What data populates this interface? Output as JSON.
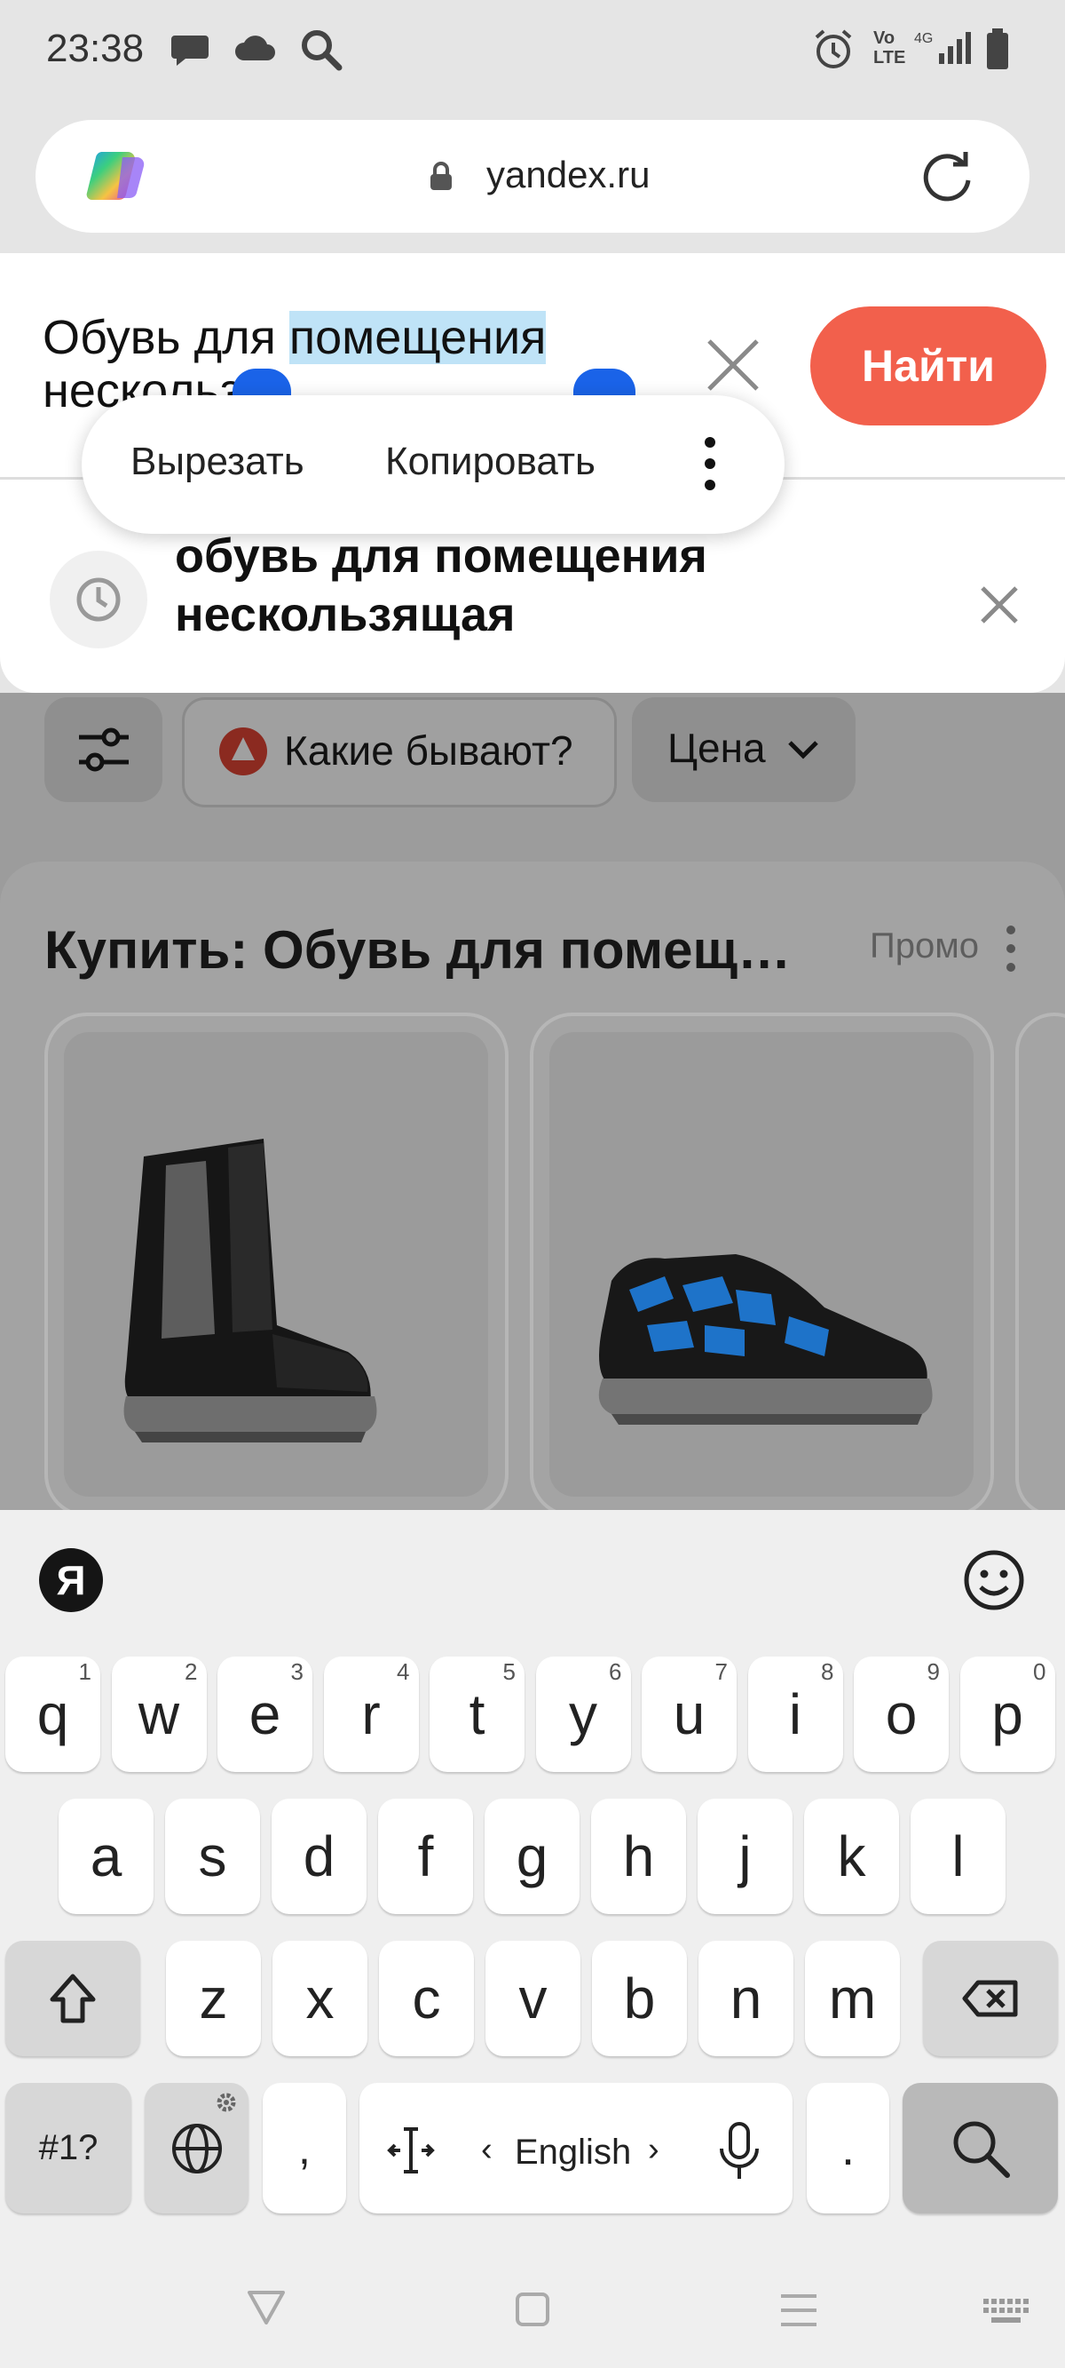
{
  "status_bar": {
    "time": "23:38"
  },
  "browser": {
    "url": "yandex.ru"
  },
  "search": {
    "query_part1": "Обувь для ",
    "query_highlight": "помещения",
    "query_line2": "нескольз",
    "find_button": "Найти",
    "context_menu": {
      "cut": "Вырезать",
      "copy": "Копировать"
    },
    "suggestion_line1": "обувь для помещения",
    "suggestion_line2": "нескользящая"
  },
  "page": {
    "chip_alice": "Какие бывают?",
    "chip_price": "Цена",
    "promo_title": "Купить: Обувь для помещ…",
    "promo_label": "Промо"
  },
  "keyboard": {
    "row1": [
      {
        "k": "q",
        "h": "1"
      },
      {
        "k": "w",
        "h": "2"
      },
      {
        "k": "e",
        "h": "3"
      },
      {
        "k": "r",
        "h": "4"
      },
      {
        "k": "t",
        "h": "5"
      },
      {
        "k": "y",
        "h": "6"
      },
      {
        "k": "u",
        "h": "7"
      },
      {
        "k": "i",
        "h": "8"
      },
      {
        "k": "o",
        "h": "9"
      },
      {
        "k": "p",
        "h": "0"
      }
    ],
    "row2": [
      "a",
      "s",
      "d",
      "f",
      "g",
      "h",
      "j",
      "k",
      "l"
    ],
    "row3": [
      "z",
      "x",
      "c",
      "v",
      "b",
      "n",
      "m"
    ],
    "symbols_key": "#1?",
    "comma_key": ",",
    "space_label": "English",
    "period_key": "."
  },
  "colors": {
    "accent": "#f2604c",
    "highlight": "#bfe3f7"
  }
}
